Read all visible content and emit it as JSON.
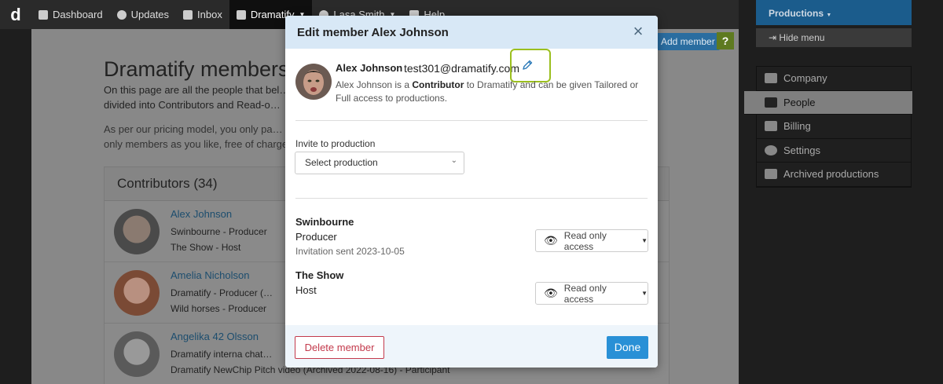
{
  "topnav": {
    "logo": "d",
    "items": [
      {
        "label": "Dashboard",
        "icon": "dashboard-icon"
      },
      {
        "label": "Updates",
        "icon": "globe-icon"
      },
      {
        "label": "Inbox",
        "icon": "inbox-icon"
      },
      {
        "label": "Dramatify",
        "icon": "briefcase-icon"
      },
      {
        "label": "Lasa Smith",
        "icon": "user-icon"
      },
      {
        "label": "Help",
        "icon": "help-icon"
      }
    ]
  },
  "page": {
    "title": "Dramatify members",
    "intro": "On this page are all the people that bel… divided into Contributors and Read-o…",
    "pricing": "As per our pricing model, you only pa… only members as you like, free of charge",
    "add_member": "Add member",
    "help_q": "?",
    "panel_title": "Contributors (34)",
    "members": [
      {
        "name": "Alex Johnson",
        "lines": [
          "Swinbourne - Producer",
          "The Show - Host"
        ]
      },
      {
        "name": "Amelia Nicholson",
        "lines": [
          "Dramatify - Producer (…",
          "Wild horses - Producer"
        ]
      },
      {
        "name": "Angelika 42 Olsson",
        "lines": [
          "Dramatify interna chat…",
          "Dramatify NewChip Pitch video (Archived 2022-08-16) - Participant"
        ]
      }
    ]
  },
  "sidebar": {
    "productions": "Productions",
    "hide_menu": "Hide menu",
    "items": [
      {
        "label": "Company",
        "icon": "briefcase-icon"
      },
      {
        "label": "People",
        "icon": "people-icon"
      },
      {
        "label": "Billing",
        "icon": "billing-icon"
      },
      {
        "label": "Settings",
        "icon": "gear-icon"
      },
      {
        "label": "Archived productions",
        "icon": "archive-icon"
      }
    ]
  },
  "modal": {
    "title": "Edit member Alex Johnson",
    "close": "×",
    "name": "Alex Johnson",
    "email": "test301@dramatify.com",
    "desc_pre": "Alex Johnson is a ",
    "desc_role": "Contributor",
    "desc_post": " to Dramatify and can be given Tailored or Full access to productions.",
    "invite_label": "Invite to production",
    "select_placeholder": "Select production",
    "productions": [
      {
        "name": "Swinbourne",
        "role": "Producer",
        "invitation": "Invitation sent 2023-10-05",
        "access": "Read only access"
      },
      {
        "name": "The Show",
        "role": "Host",
        "invitation": "",
        "access": "Read only access"
      }
    ],
    "delete_label": "Delete member",
    "done_label": "Done"
  },
  "colors": {
    "highlight": "#9bbf1e",
    "primary": "#2990d6",
    "danger": "#c33a4c"
  }
}
